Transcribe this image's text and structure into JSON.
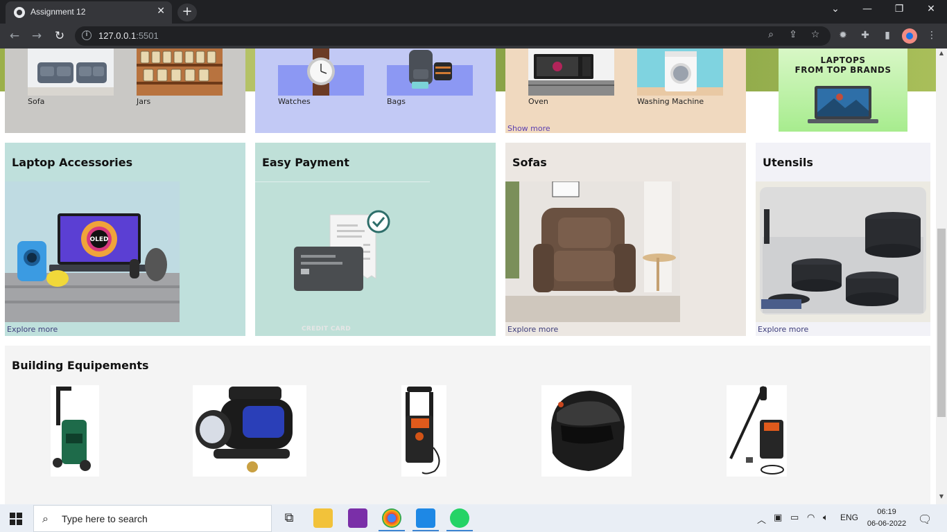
{
  "browser": {
    "tab_title": "Assignment 12",
    "url_host": "127.0.0.1",
    "url_port": ":5501"
  },
  "top_row": {
    "card1": {
      "items": [
        {
          "label": "Sofa"
        },
        {
          "label": "Jars"
        }
      ],
      "bg": "#c9c8c5"
    },
    "card2": {
      "items": [
        {
          "label": "Watches"
        },
        {
          "label": "Bags"
        }
      ],
      "bg": "#c2c9f5"
    },
    "card3": {
      "items": [
        {
          "label": "Oven"
        },
        {
          "label": "Washing Machine"
        }
      ],
      "link": "Show more",
      "bg": "#f0d9bf"
    },
    "card4": {
      "banner_line1": "LAPTOPS",
      "banner_line2": "FROM TOP BRANDS"
    }
  },
  "middle_row": [
    {
      "title": "Laptop Accessories",
      "link": "Explore more",
      "bg": "#bfe0dc"
    },
    {
      "title": "Easy Payment",
      "card_text": "CREDIT CARD",
      "bg": "#bfe0d8"
    },
    {
      "title": "Sofas",
      "link": "Explore more",
      "bg": "#ece7e2"
    },
    {
      "title": "Utensils",
      "link": "Explore more",
      "bg": "#f2f2f7"
    }
  ],
  "building": {
    "title": "Building Equipements"
  },
  "taskbar": {
    "search_placeholder": "Type here to search",
    "lang": "ENG",
    "time": "06:19",
    "date": "06-06-2022"
  }
}
